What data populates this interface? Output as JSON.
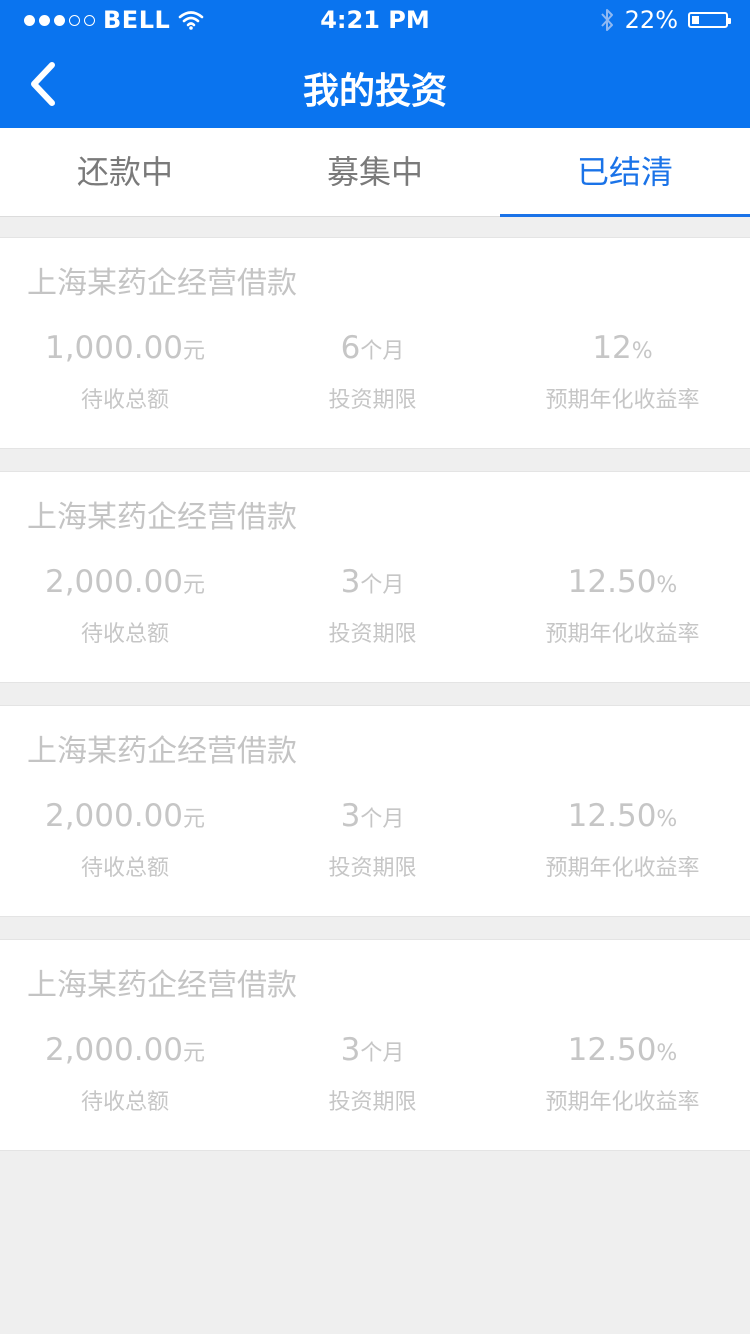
{
  "status_bar": {
    "carrier": "BELL",
    "time": "4:21 PM",
    "battery": "22%",
    "battery_level": 0.22
  },
  "nav": {
    "title": "我的投资"
  },
  "tabs": [
    {
      "label": "还款中",
      "active": false
    },
    {
      "label": "募集中",
      "active": false
    },
    {
      "label": "已结清",
      "active": true
    }
  ],
  "investments": [
    {
      "title": "上海某药企经营借款",
      "amount": "1,000.00",
      "amount_unit": "元",
      "amount_label": "待收总额",
      "term": "6",
      "term_unit": "个月",
      "term_label": "投资期限",
      "rate": "12",
      "rate_unit": "%",
      "rate_label": "预期年化收益率"
    },
    {
      "title": "上海某药企经营借款",
      "amount": "2,000.00",
      "amount_unit": "元",
      "amount_label": "待收总额",
      "term": "3",
      "term_unit": "个月",
      "term_label": "投资期限",
      "rate": "12.50",
      "rate_unit": "%",
      "rate_label": "预期年化收益率"
    },
    {
      "title": "上海某药企经营借款",
      "amount": "2,000.00",
      "amount_unit": "元",
      "amount_label": "待收总额",
      "term": "3",
      "term_unit": "个月",
      "term_label": "投资期限",
      "rate": "12.50",
      "rate_unit": "%",
      "rate_label": "预期年化收益率"
    },
    {
      "title": "上海某药企经营借款",
      "amount": "2,000.00",
      "amount_unit": "元",
      "amount_label": "待收总额",
      "term": "3",
      "term_unit": "个月",
      "term_label": "投资期限",
      "rate": "12.50",
      "rate_unit": "%",
      "rate_label": "预期年化收益率"
    }
  ],
  "colors": {
    "accent": "#0a74ef",
    "tab_active": "#1a73e8",
    "muted_text": "#c6c6c6",
    "background": "#efefef"
  },
  "icons": [
    "signal-dots-icon",
    "wifi-icon",
    "bluetooth-icon",
    "battery-icon",
    "back-chevron-icon"
  ]
}
